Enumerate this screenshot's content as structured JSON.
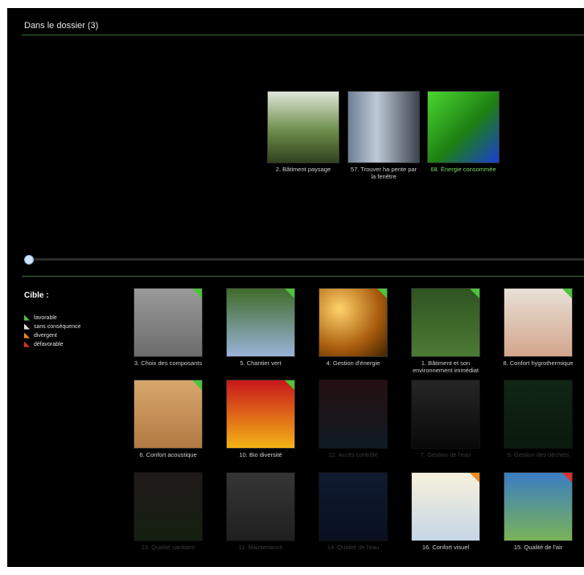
{
  "folder": {
    "title": "Dans le dossier (3)",
    "items": [
      {
        "label": "2. Bâtiment paysage",
        "highlight": false
      },
      {
        "label": "57. Trouver ha pente par la fenêtre",
        "highlight": false
      },
      {
        "label": "68. Énergie consommée",
        "highlight": true
      }
    ],
    "slider_position": 0.0
  },
  "legend": {
    "title": "Cible :",
    "items": [
      {
        "label": "favorable",
        "color": "#4cc43c"
      },
      {
        "label": "sans conséquence",
        "color": "#e3e3e3"
      },
      {
        "label": "divergent",
        "color": "#f28a1e"
      },
      {
        "label": "défavorable",
        "color": "#e0302a"
      }
    ]
  },
  "grid": [
    {
      "label": "3. Choix des composants",
      "flag": "#4cc43c",
      "dim": false,
      "bg": "linear-gradient(#9a9a9a,#6c6c6c)"
    },
    {
      "label": "5. Chantier vert",
      "flag": "#4cc43c",
      "dim": false,
      "bg": "linear-gradient(#3f6c2a,#9ab3d9)"
    },
    {
      "label": "4. Gestion d'énergie",
      "flag": "#4cc43c",
      "dim": false,
      "bg": "radial-gradient(circle at 30% 30%,#ffd36b,#a85b0c 60%,#402303)"
    },
    {
      "label": "1. Bâtiment et son environnement immédiat",
      "flag": "#4cc43c",
      "dim": false,
      "bg": "linear-gradient(#2f5421,#4c7a34)"
    },
    {
      "label": "8. Confort hygrothermique",
      "flag": "#4cc43c",
      "dim": false,
      "bg": "linear-gradient(#e8e0d6,#d3a58c)"
    },
    {
      "label": "6. Confort acoustique",
      "flag": "#4cc43c",
      "dim": false,
      "bg": "linear-gradient(#d9a66e,#b07a43)"
    },
    {
      "label": "10. Bio diversité",
      "flag": "#4cc43c",
      "dim": false,
      "bg": "linear-gradient(#c8171b,#f3b315)"
    },
    {
      "label": "12. Accès contrôlé",
      "flag": "",
      "dim": true,
      "bg": "linear-gradient(#6b2c2c,#2d4e6a)"
    },
    {
      "label": "7. Gestion de l'eau",
      "flag": "",
      "dim": true,
      "bg": "linear-gradient(#6d6d6d,#1a1a1a)"
    },
    {
      "label": "9. Gestion des déchets",
      "flag": "",
      "dim": true,
      "bg": "linear-gradient(#2f6e3b,#1d4a26)"
    },
    {
      "label": "13. Qualité sanitaire",
      "flag": "",
      "dim": true,
      "bg": "linear-gradient(#5a4a4a,#3b5a2d)"
    },
    {
      "label": "11. Maintenance",
      "flag": "",
      "dim": true,
      "bg": "linear-gradient(#9a9a9a,#5a5a5a)"
    },
    {
      "label": "14. Qualité de l'eau",
      "flag": "",
      "dim": true,
      "bg": "linear-gradient(#2d4c8a,#1a2e5a)"
    },
    {
      "label": "16. Confort visuel",
      "flag": "#f28a1e",
      "dim": false,
      "bg": "linear-gradient(#f7f0dc,#c6d7e6)"
    },
    {
      "label": "15. Qualité de l'air",
      "flag": "#e0302a",
      "dim": false,
      "bg": "linear-gradient(#3a7dc4,#7ab357)"
    }
  ]
}
